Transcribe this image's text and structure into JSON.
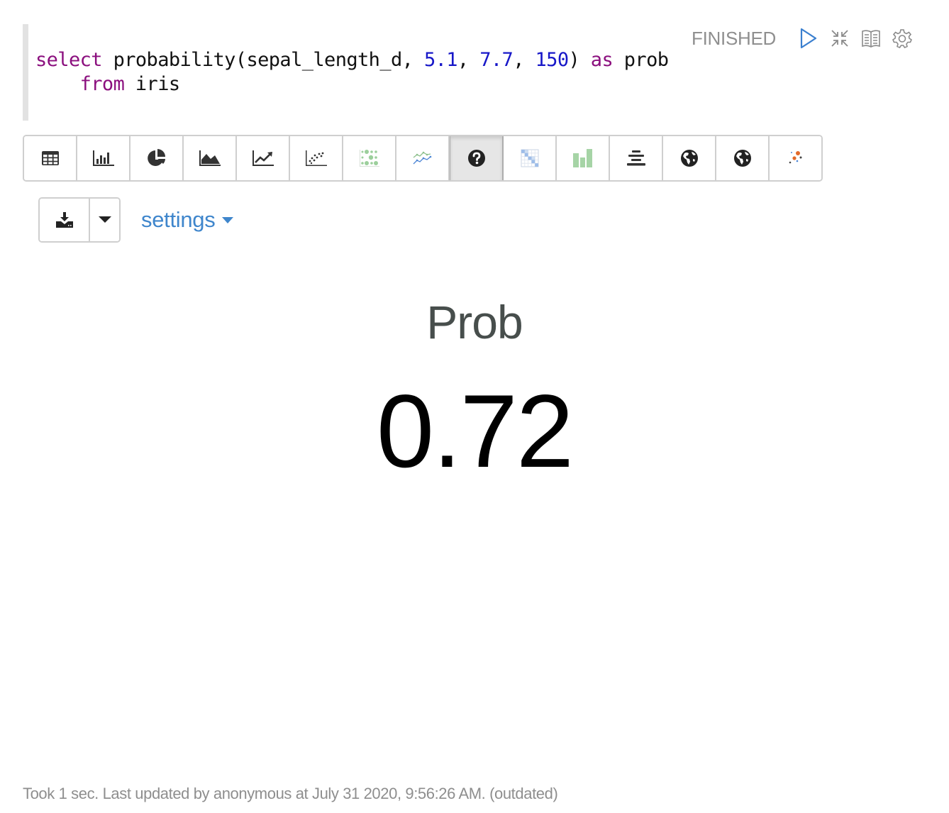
{
  "editor": {
    "line1": {
      "kw_select": "select",
      "fn_text": " probability(sepal_length_d, ",
      "n1": "5.1",
      "sep1": ", ",
      "n2": "7.7",
      "sep2": ", ",
      "n3": "150",
      "close": ") ",
      "kw_as": "as",
      "alias": " prob"
    },
    "line2": {
      "indent": "    ",
      "kw_from": "from",
      "table": " iris"
    }
  },
  "paragraph_controls": {
    "status": "FINISHED",
    "run_icon": "play-icon",
    "collapse_icon": "compress-icon",
    "book_icon": "book-icon",
    "settings_icon": "gear-icon"
  },
  "viz_toolbar": {
    "buttons": [
      {
        "name": "table",
        "icon": "table-icon",
        "active": false
      },
      {
        "name": "bar-chart",
        "icon": "bar-chart-icon",
        "active": false
      },
      {
        "name": "pie-chart",
        "icon": "pie-chart-icon",
        "active": false
      },
      {
        "name": "area-chart",
        "icon": "area-chart-icon",
        "active": false
      },
      {
        "name": "line-chart",
        "icon": "line-chart-icon",
        "active": false
      },
      {
        "name": "scatter-chart",
        "icon": "scatter-chart-icon",
        "active": false
      },
      {
        "name": "bubble-chart",
        "icon": "bubble-chart-icon",
        "active": false
      },
      {
        "name": "multi-line-chart",
        "icon": "multi-line-chart-icon",
        "active": false
      },
      {
        "name": "unknown",
        "icon": "question-circle-icon",
        "active": true
      },
      {
        "name": "heatmap",
        "icon": "heatmap-icon",
        "active": false
      },
      {
        "name": "column-chart",
        "icon": "column-chart-icon",
        "active": false
      },
      {
        "name": "funnel-chart",
        "icon": "funnel-icon",
        "active": false
      },
      {
        "name": "globe-map",
        "icon": "globe-icon",
        "active": false
      },
      {
        "name": "globe-map-2",
        "icon": "globe-icon",
        "active": false
      },
      {
        "name": "cluster-scatter",
        "icon": "cluster-scatter-icon",
        "active": false
      }
    ]
  },
  "download": {
    "icon": "download-icon",
    "caret_icon": "caret-down-icon"
  },
  "settings": {
    "label": "settings"
  },
  "result": {
    "label": "Prob",
    "value": "0.72"
  },
  "footer": {
    "text": "Took 1 sec. Last updated by anonymous at July 31 2020, 9:56:26 AM. (outdated)"
  },
  "colors": {
    "keyword": "#8b0f7e",
    "number": "#1717c8",
    "link": "#3f86cc",
    "status": "#8f8f8f"
  }
}
